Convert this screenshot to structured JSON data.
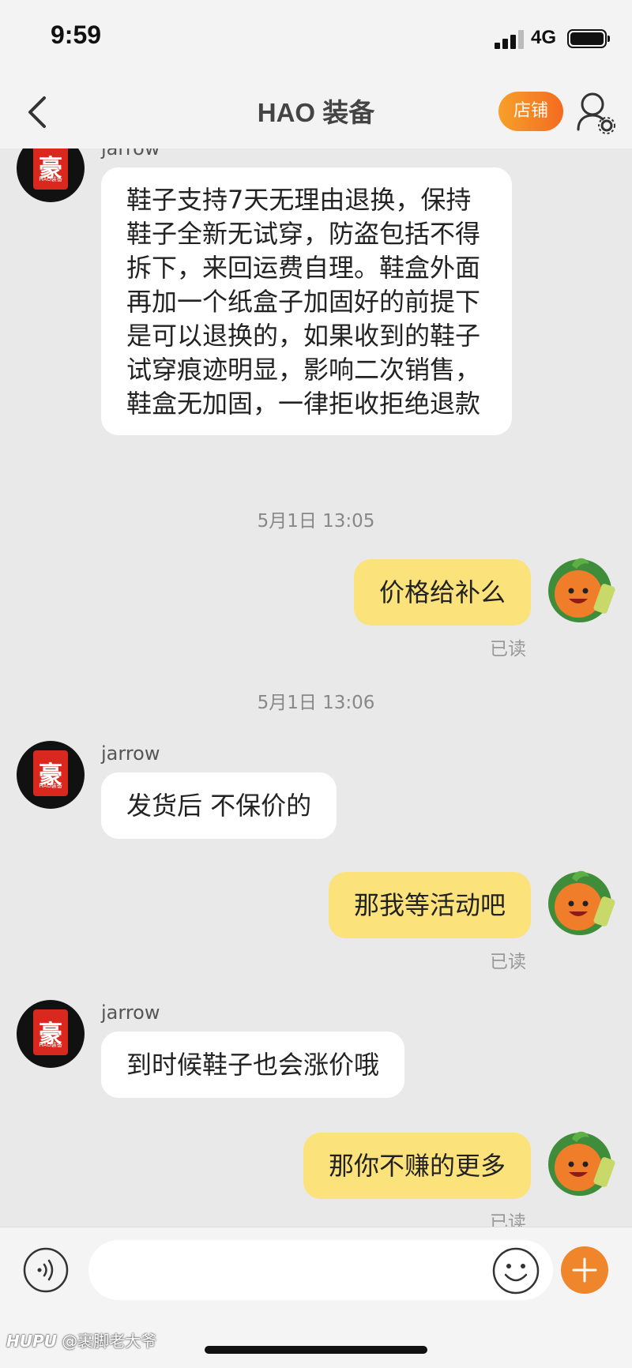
{
  "status_bar": {
    "time": "9:59",
    "network": "4G"
  },
  "nav": {
    "title": "HAO 装备",
    "shop_label": "店铺"
  },
  "shop_avatar": {
    "glyph": "豪",
    "tiny": "HAO装备"
  },
  "messages": [
    {
      "sender": "jarrow",
      "text": "鞋子支持7天无理由退换，保持鞋子全新无试穿，防盗包括不得拆下，来回运费自理。鞋盒外面再加一个纸盒子加固好的前提下是可以退换的，如果收到的鞋子试穿痕迹明显，影响二次销售，鞋盒无加固，一律拒收拒绝退款"
    },
    {
      "timestamp": "5月1日 13:05"
    },
    {
      "text": "价格给补么",
      "read": "已读"
    },
    {
      "timestamp": "5月1日 13:06"
    },
    {
      "sender": "jarrow",
      "text": "发货后 不保价的"
    },
    {
      "text": "那我等活动吧",
      "read": "已读"
    },
    {
      "sender": "jarrow",
      "text": "到时候鞋子也会涨价哦"
    },
    {
      "text": "那你不赚的更多",
      "read": "已读"
    }
  ],
  "input": {
    "placeholder": ""
  },
  "watermark": {
    "brand": "HUPU",
    "handle": "@裹脚老大爷"
  }
}
